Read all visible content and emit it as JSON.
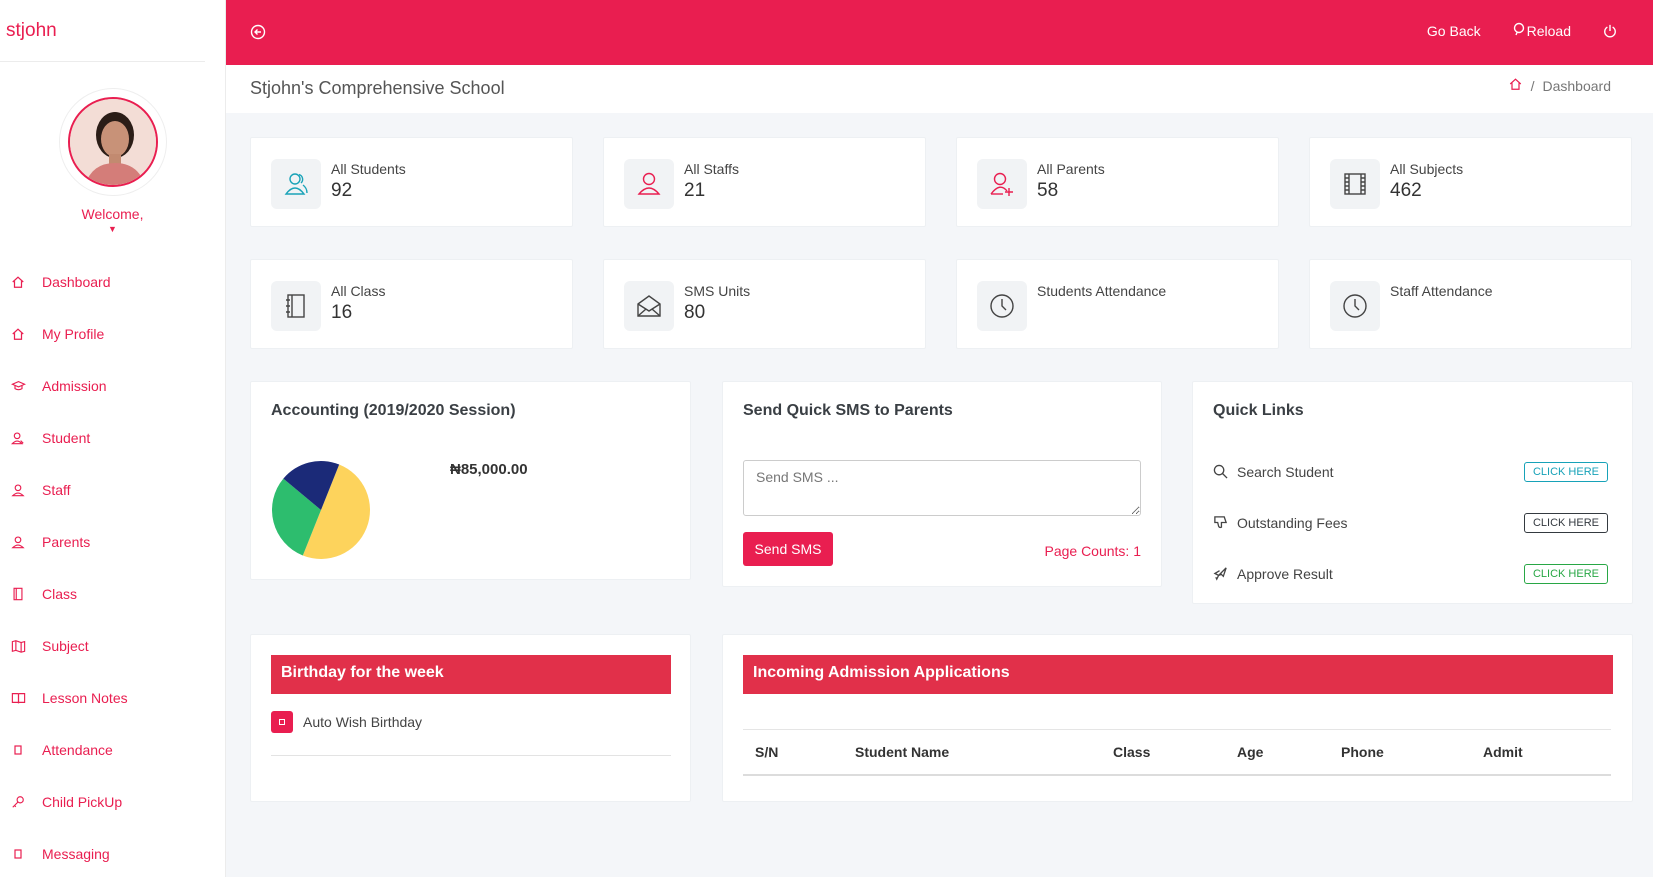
{
  "brand": "stjohn",
  "sidebar": {
    "welcome": "Welcome,",
    "items": [
      {
        "label": "Dashboard",
        "icon": "home-icon"
      },
      {
        "label": "My Profile",
        "icon": "home-icon"
      },
      {
        "label": "Admission",
        "icon": "graduation-cap-icon"
      },
      {
        "label": "Student",
        "icon": "student-icon"
      },
      {
        "label": "Staff",
        "icon": "user-icon"
      },
      {
        "label": "Parents",
        "icon": "user-icon"
      },
      {
        "label": "Class",
        "icon": "book-icon"
      },
      {
        "label": "Subject",
        "icon": "map-icon"
      },
      {
        "label": "Lesson Notes",
        "icon": "notebook-icon"
      },
      {
        "label": "Attendance",
        "icon": "small-square-icon"
      },
      {
        "label": "Child PickUp",
        "icon": "key-icon"
      },
      {
        "label": "Messaging",
        "icon": "small-square-icon"
      }
    ]
  },
  "topbar": {
    "go_back": "Go Back",
    "reload": "Reload"
  },
  "header": {
    "school_name": "Stjohn's Comprehensive School",
    "breadcrumb_sep": "/",
    "breadcrumb_current": "Dashboard"
  },
  "stats": [
    {
      "label": "All Students",
      "value": "92",
      "icon": "users-icon"
    },
    {
      "label": "All Staffs",
      "value": "21",
      "icon": "user-icon"
    },
    {
      "label": "All Parents",
      "value": "58",
      "icon": "user-plus-icon"
    },
    {
      "label": "All Subjects",
      "value": "462",
      "icon": "film-icon"
    },
    {
      "label": "All Class",
      "value": "16",
      "icon": "notebook-icon"
    },
    {
      "label": "SMS Units",
      "value": "80",
      "icon": "envelope-open-icon"
    },
    {
      "label": "Students Attendance",
      "value": "",
      "icon": "clock-icon"
    },
    {
      "label": "Staff Attendance",
      "value": "",
      "icon": "clock-icon"
    }
  ],
  "accounting": {
    "title": "Accounting (2019/2020 Session)",
    "amount": "₦85,000.00"
  },
  "chart_data": {
    "type": "pie",
    "colors": [
      "#fdd35c",
      "#2dbd6e",
      "#1b2a78"
    ],
    "values": [
      50,
      30,
      20
    ]
  },
  "sms": {
    "title": "Send Quick SMS to Parents",
    "placeholder": "Send SMS ...",
    "button": "Send SMS",
    "page_counts": "Page Counts: 1"
  },
  "quick_links": {
    "title": "Quick Links",
    "items": [
      {
        "label": "Search Student",
        "button": "CLICK HERE",
        "color": "#17a2b8",
        "icon": "search-icon"
      },
      {
        "label": "Outstanding Fees",
        "button": "CLICK HERE",
        "color": "#343a40",
        "icon": "thumbs-down-icon"
      },
      {
        "label": "Approve Result",
        "button": "CLICK HERE",
        "color": "#28a745",
        "icon": "rocket-icon"
      }
    ]
  },
  "birthday": {
    "title": "Birthday for the week",
    "auto_wish": "Auto Wish Birthday"
  },
  "admissions": {
    "title": "Incoming Admission Applications",
    "columns": [
      "S/N",
      "Student Name",
      "Class",
      "Age",
      "Phone",
      "Admit"
    ]
  },
  "colors": {
    "primary": "#e91e50",
    "bar_red": "#e1304a"
  }
}
